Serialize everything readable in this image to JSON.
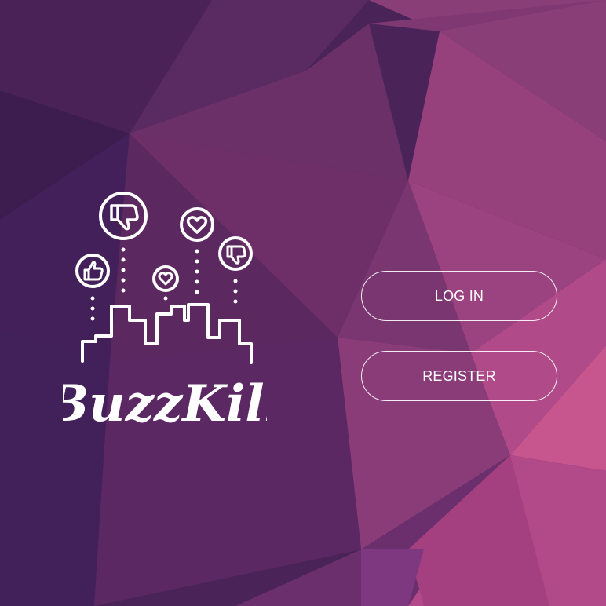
{
  "brand": {
    "name": "BuzzKill",
    "logo_icons": [
      "thumbs-up-icon",
      "thumbs-down-icon",
      "heart-icon",
      "heart-icon",
      "thumbs-down-icon",
      "city-skyline-icon"
    ]
  },
  "auth": {
    "login_label": "LOG IN",
    "register_label": "REGISTER"
  },
  "colors": {
    "background_base": "#4a2358",
    "background_accent": "#c4538c",
    "button_border": "#ffffff",
    "text": "#ffffff"
  }
}
